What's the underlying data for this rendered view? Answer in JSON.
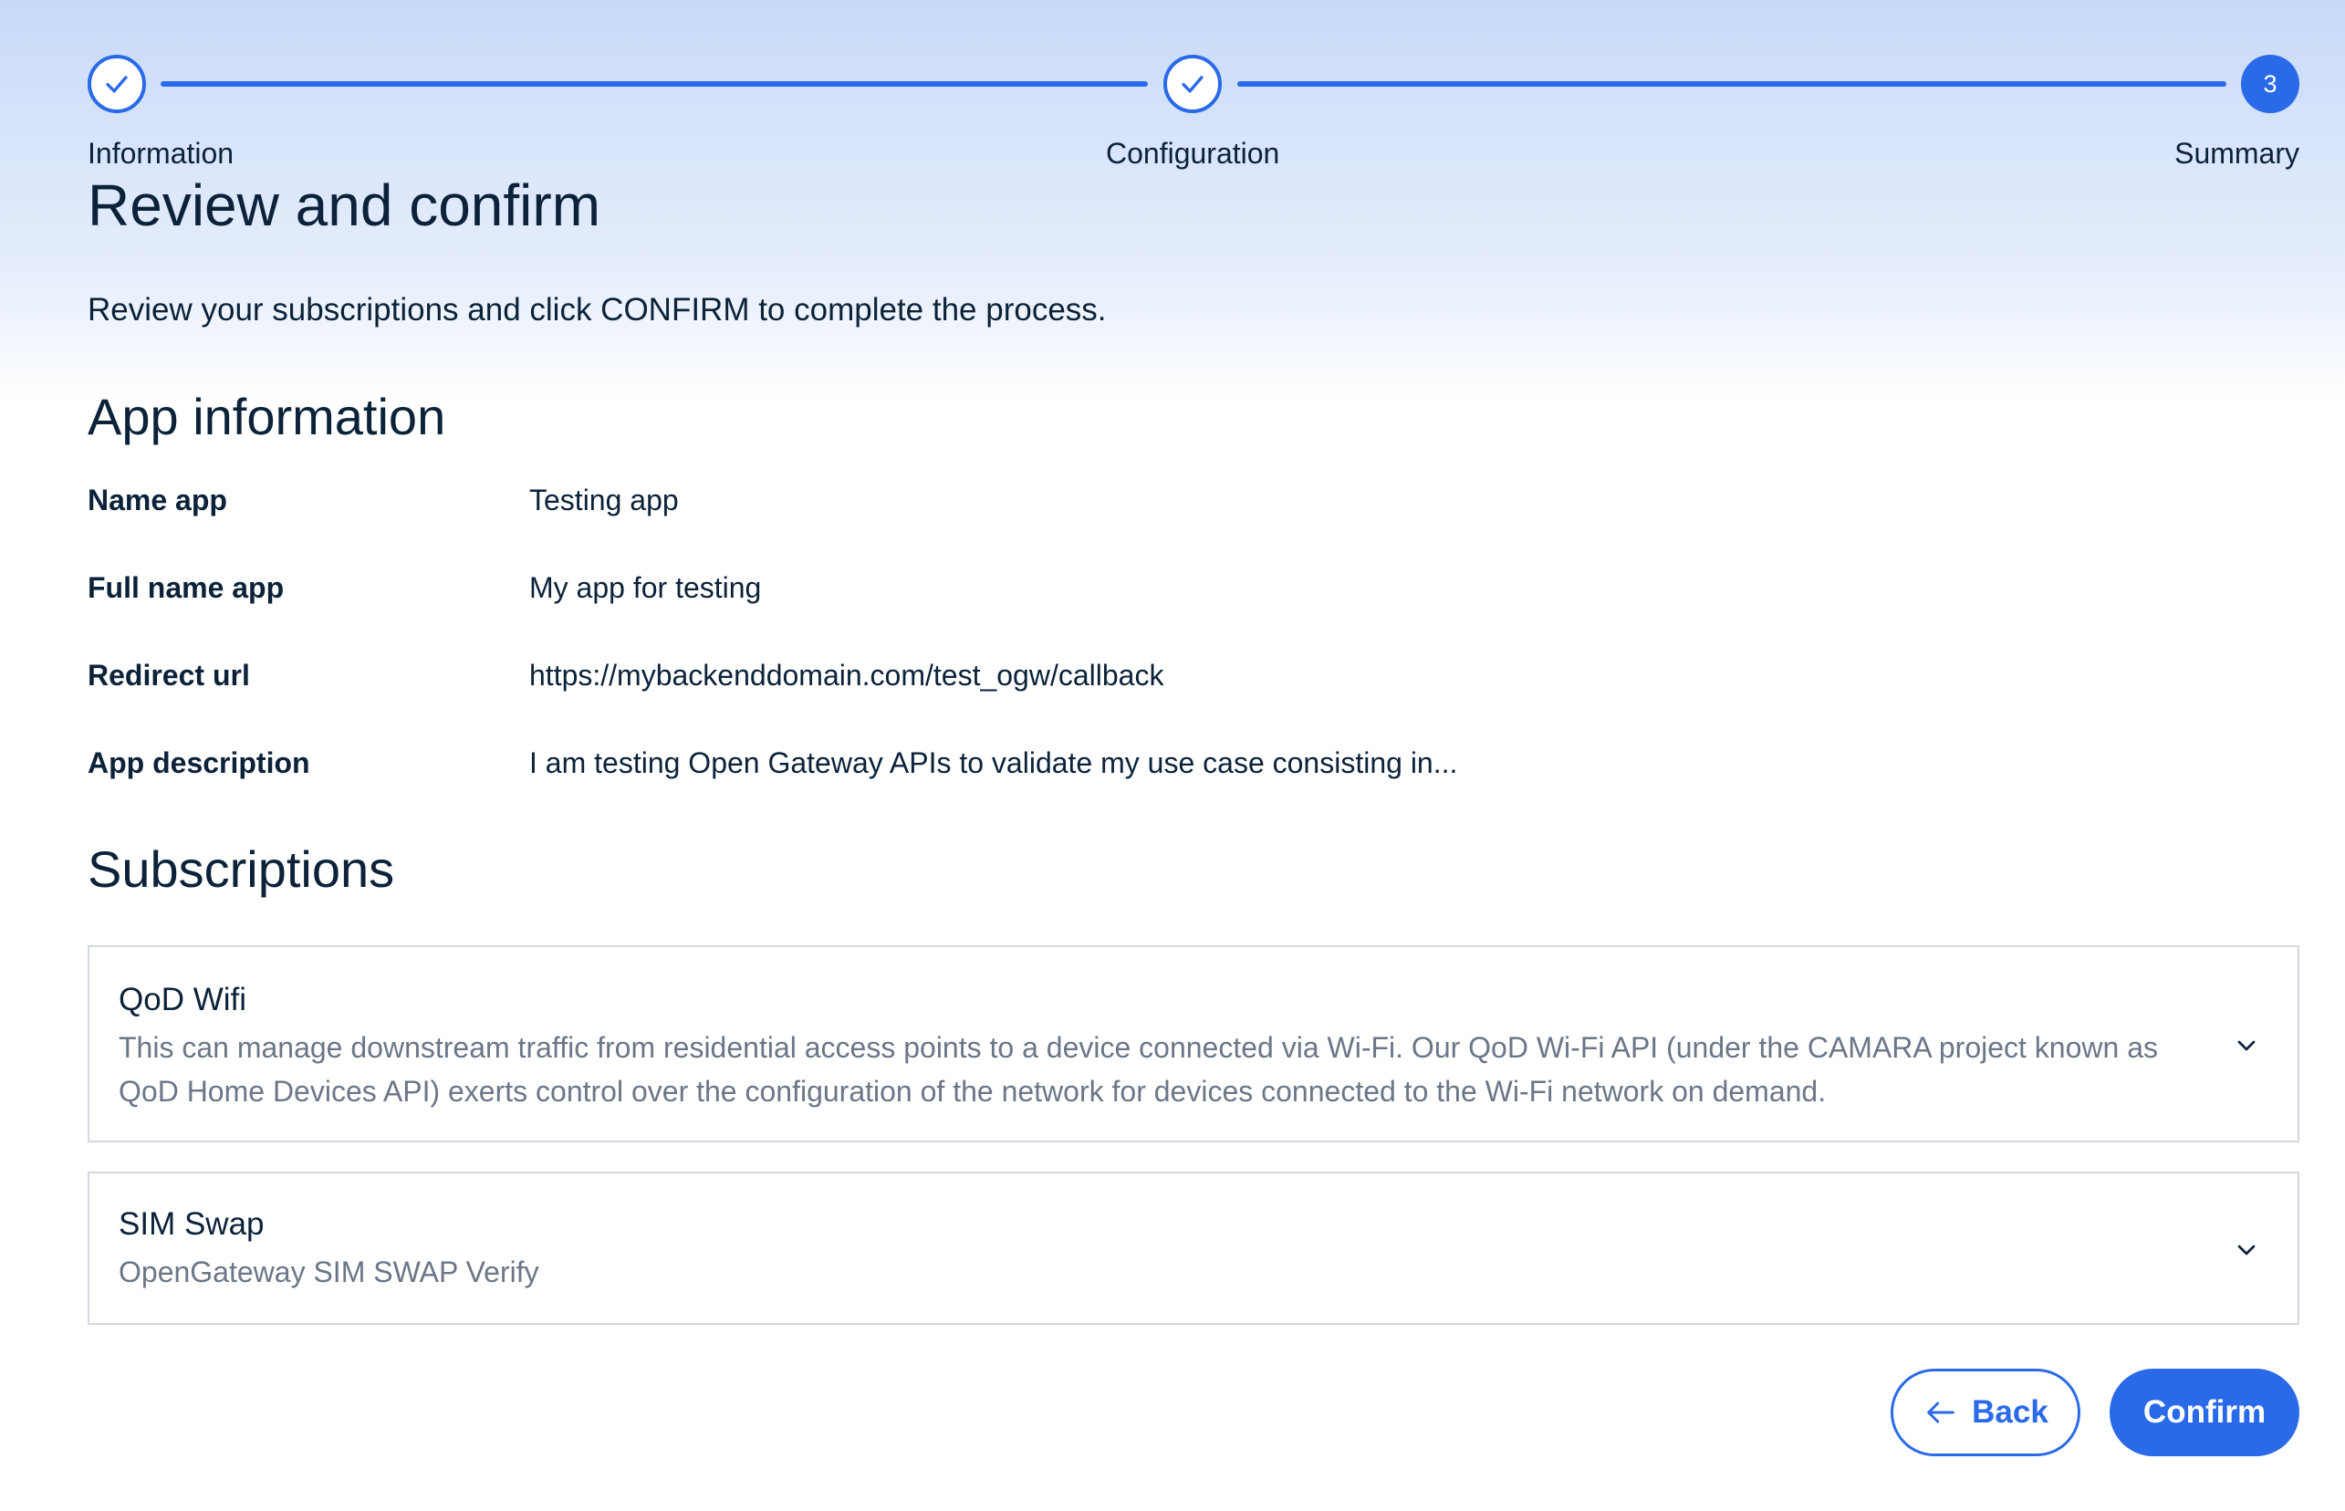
{
  "stepper": {
    "steps": [
      {
        "label": "Information",
        "state": "completed",
        "icon": "check-icon"
      },
      {
        "label": "Configuration",
        "state": "completed",
        "icon": "check-icon"
      },
      {
        "label": "Summary",
        "state": "active",
        "number": "3"
      }
    ]
  },
  "page": {
    "title": "Review and confirm",
    "subtitle": "Review your subscriptions and click CONFIRM to complete the process."
  },
  "app_information": {
    "heading": "App information",
    "rows": [
      {
        "label": "Name app",
        "value": "Testing app"
      },
      {
        "label": "Full name app",
        "value": "My app for testing"
      },
      {
        "label": "Redirect url",
        "value": "https://mybackenddomain.com/test_ogw/callback"
      },
      {
        "label": "App description",
        "value": "I am testing Open Gateway APIs to validate my use case consisting in..."
      }
    ]
  },
  "subscriptions": {
    "heading": "Subscriptions",
    "items": [
      {
        "title": "QoD Wifi",
        "description": "This can manage downstream traffic from residential access points to a device connected via Wi-Fi. Our QoD Wi-Fi API (under the CAMARA project known as QoD Home Devices API) exerts control over the configuration of the network for devices connected to the Wi-Fi network on demand.",
        "icon": "chevron-down-icon"
      },
      {
        "title": "SIM Swap",
        "description": "OpenGateway SIM SWAP Verify",
        "icon": "chevron-down-icon"
      }
    ]
  },
  "actions": {
    "back_label": "Back",
    "back_icon": "arrow-left-icon",
    "confirm_label": "Confirm"
  },
  "colors": {
    "accent": "#2a6ae8",
    "text": "#0b2239",
    "muted_text": "#6b7687",
    "card_border": "#d4d8df"
  }
}
